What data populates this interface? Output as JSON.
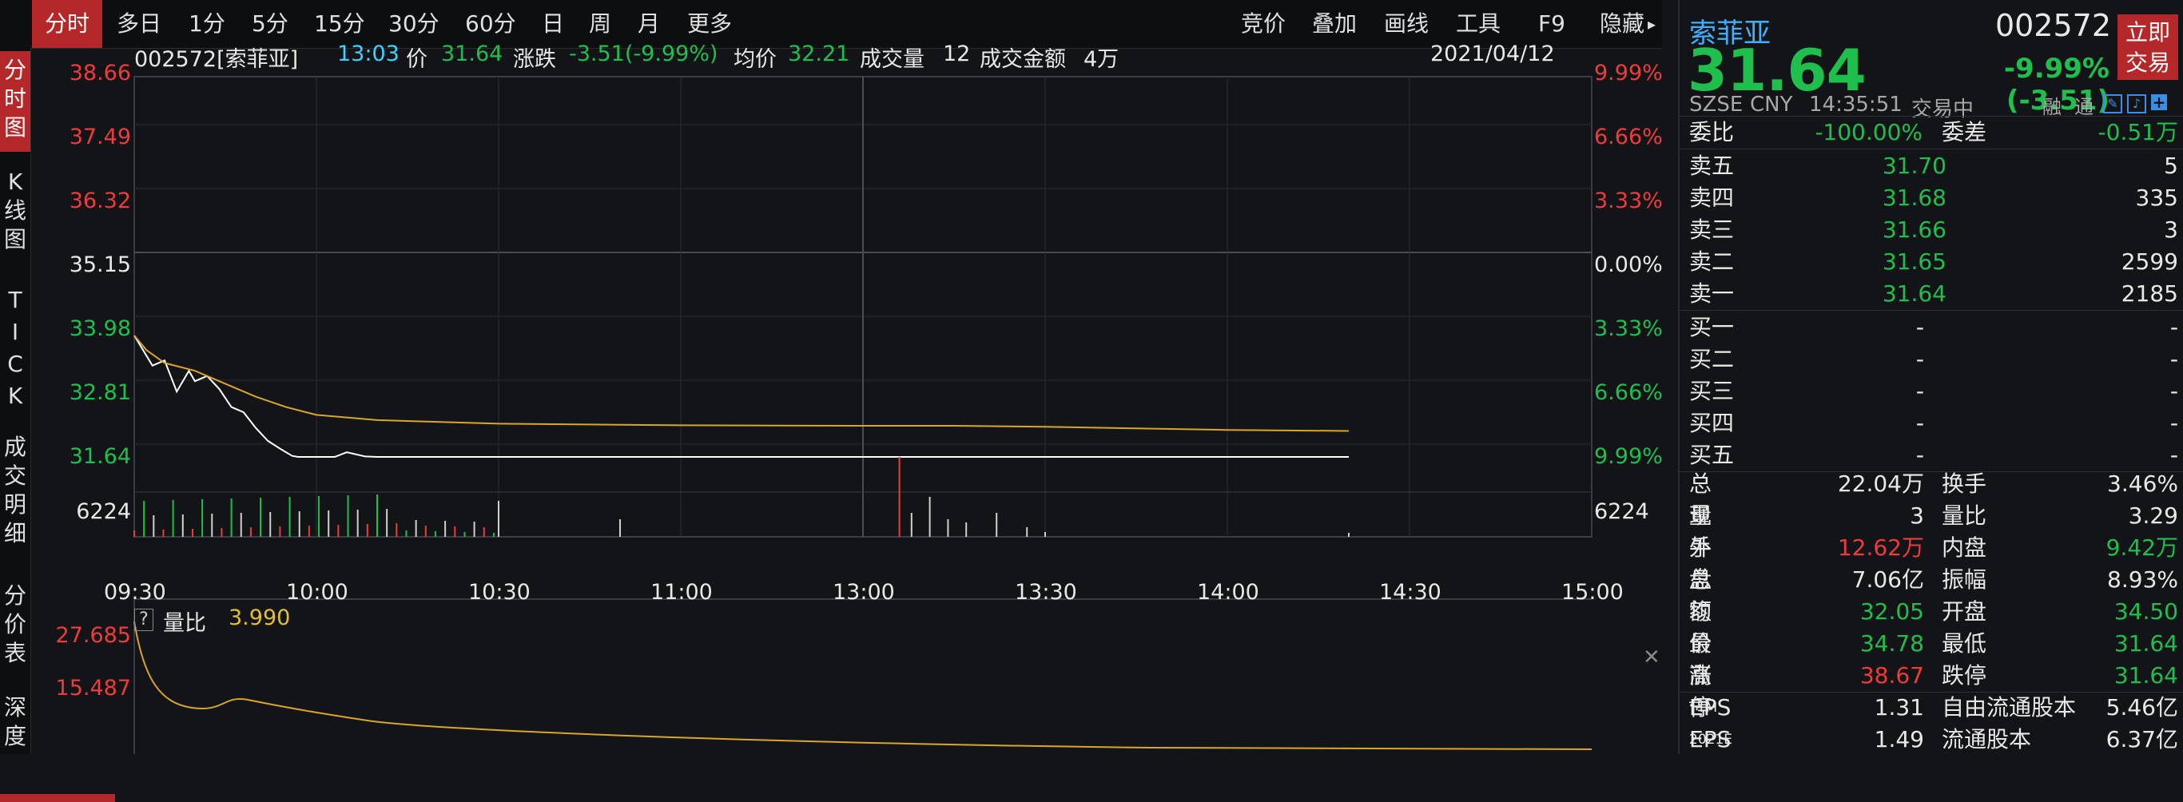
{
  "toolbar": {
    "tabs": [
      "分时",
      "多日",
      "1分",
      "5分",
      "15分",
      "30分",
      "60分",
      "日",
      "周",
      "月",
      "更多"
    ],
    "active": "分时",
    "right": [
      "竞价",
      "叠加",
      "画线",
      "工具",
      "F9",
      "隐藏"
    ]
  },
  "leftnav": [
    {
      "label": "分时图"
    },
    {
      "label": "K线图"
    },
    {
      "label": "TICK"
    },
    {
      "label": "成交明细"
    },
    {
      "label": "分价表"
    },
    {
      "label": "深度"
    }
  ],
  "infobar": {
    "code_name": "002572[索菲亚]",
    "time": "13:03",
    "price_label": "价",
    "price": "31.64",
    "change_label": "涨跌",
    "change": "-3.51(-9.99%)",
    "avg_label": "均价",
    "avg": "32.21",
    "vol_label": "成交量",
    "vol": "12",
    "amount_label": "成交金额",
    "amount": "4万",
    "date": "2021/04/12"
  },
  "chart_data": [
    {
      "type": "line",
      "title": "",
      "y_left_ticks": [
        "38.66",
        "37.49",
        "36.32",
        "35.15",
        "33.98",
        "32.81",
        "31.64"
      ],
      "y_right_ticks": [
        "9.99%",
        "6.66%",
        "3.33%",
        "0.00%",
        "3.33%",
        "6.66%",
        "9.99%"
      ],
      "x_ticks": [
        "09:30",
        "10:00",
        "10:30",
        "11:00",
        "13:00",
        "13:30",
        "14:00",
        "14:30",
        "15:00"
      ],
      "ylim": [
        31.64,
        38.66
      ],
      "series": [
        {
          "name": "价",
          "color": "#ffffff",
          "x": [
            0,
            3,
            5,
            7,
            9,
            10,
            12,
            14,
            16,
            18,
            20,
            22,
            24,
            26,
            27,
            28,
            30,
            33,
            35,
            38,
            40,
            45,
            60,
            120,
            135,
            150,
            165,
            200
          ],
          "y": [
            33.98,
            33.4,
            33.5,
            32.9,
            33.3,
            33.1,
            33.2,
            32.95,
            32.6,
            32.5,
            32.2,
            31.95,
            31.8,
            31.66,
            31.64,
            31.64,
            31.64,
            31.64,
            31.73,
            31.65,
            31.64,
            31.64,
            31.64,
            31.64,
            31.64,
            31.64,
            31.64,
            31.64
          ]
        },
        {
          "name": "均价",
          "color": "#d9a52b",
          "x": [
            0,
            2,
            5,
            10,
            15,
            20,
            25,
            30,
            40,
            60,
            90,
            120,
            135,
            150,
            180,
            200
          ],
          "y": [
            33.98,
            33.7,
            33.45,
            33.3,
            33.05,
            32.8,
            32.6,
            32.45,
            32.35,
            32.28,
            32.25,
            32.24,
            32.24,
            32.22,
            32.16,
            32.14
          ]
        }
      ],
      "volume_label": "6224",
      "volume_max": 6224
    },
    {
      "type": "line",
      "title": "量比",
      "value": "3.990",
      "y_ticks": [
        "27.685",
        "15.487"
      ]
    }
  ],
  "panel": {
    "name": "索菲亚",
    "code": "002572",
    "price": "31.64",
    "change": "-9.99% (-3.51)",
    "trade_btn": "立即交易",
    "exchange": "SZSE",
    "currency": "CNY",
    "time": "14:35:51",
    "status": "交易中",
    "flags": [
      "融",
      "通"
    ],
    "weibi_label": "委比",
    "weibi": "-100.00%",
    "weicha_label": "委差",
    "weicha": "-0.51万",
    "asks": [
      {
        "label": "卖五",
        "price": "31.70",
        "vol": "5"
      },
      {
        "label": "卖四",
        "price": "31.68",
        "vol": "335"
      },
      {
        "label": "卖三",
        "price": "31.66",
        "vol": "3"
      },
      {
        "label": "卖二",
        "price": "31.65",
        "vol": "2599"
      },
      {
        "label": "卖一",
        "price": "31.64",
        "vol": "2185"
      }
    ],
    "bids": [
      {
        "label": "买一",
        "price": "-",
        "vol": "-"
      },
      {
        "label": "买二",
        "price": "-",
        "vol": "-"
      },
      {
        "label": "买三",
        "price": "-",
        "vol": "-"
      },
      {
        "label": "买四",
        "price": "-",
        "vol": "-"
      },
      {
        "label": "买五",
        "price": "-",
        "vol": "-"
      }
    ],
    "stats": [
      {
        "l1": "总量",
        "v1": "22.04万",
        "c1": "white",
        "l2": "换手",
        "v2": "3.46%",
        "c2": "white"
      },
      {
        "l1": "现手",
        "v1": "3",
        "c1": "white",
        "l2": "量比",
        "v2": "3.29",
        "c2": "white"
      },
      {
        "l1": "外盘",
        "v1": "12.62万",
        "c1": "red",
        "l2": "内盘",
        "v2": "9.42万",
        "c2": "green"
      },
      {
        "l1": "总额",
        "v1": "7.06亿",
        "c1": "white",
        "l2": "振幅",
        "v2": "8.93%",
        "c2": "white"
      },
      {
        "l1": "均价",
        "v1": "32.05",
        "c1": "green",
        "l2": "开盘",
        "v2": "34.50",
        "c2": "green"
      },
      {
        "l1": "最高",
        "v1": "34.78",
        "c1": "green",
        "l2": "最低",
        "v2": "31.64",
        "c2": "green"
      },
      {
        "l1": "涨停",
        "v1": "38.67",
        "c1": "red",
        "l2": "跌停",
        "v2": "31.64",
        "c2": "green"
      },
      {
        "l1": "EPS",
        "sup1": "TTM",
        "v1": "1.31",
        "c1": "white",
        "l2": "自由流通股本",
        "v2": "5.46亿",
        "c2": "white"
      },
      {
        "l1": "EPS",
        "sup1": "2021E",
        "v1": "1.49",
        "c1": "white",
        "l2": "流通股本",
        "v2": "6.37亿",
        "c2": "white"
      }
    ]
  },
  "colors": {
    "up": "#ee3b3b",
    "down": "#1fbf4e",
    "accent": "#b5282a",
    "avg": "#d9a52b",
    "bg": "#131417"
  }
}
